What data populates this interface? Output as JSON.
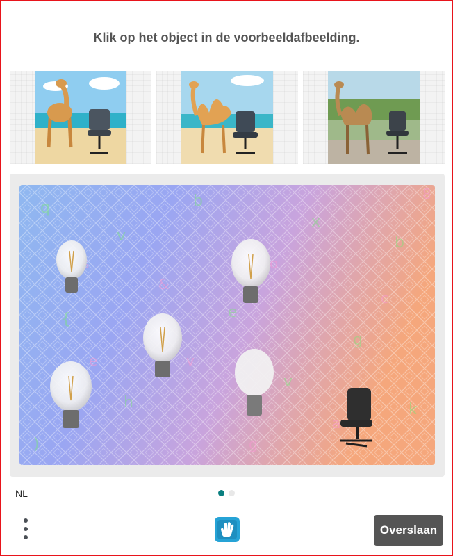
{
  "prompt": {
    "text": "Klik op het object in de voorbeeldafbeelding."
  },
  "examples": [
    {
      "icon": "camel-and-office-chair-on-beach-image"
    },
    {
      "icon": "camel-and-office-chair-on-beach-image"
    },
    {
      "icon": "camel-and-office-chair-in-park-image"
    }
  ],
  "task": {
    "icon": "light-bulbs-and-office-chair-image"
  },
  "footer": {
    "language": "NL",
    "pages_total": 2,
    "page_current": 1,
    "skip_label": "Overslaan",
    "menu_icon": "vertical-dots-icon",
    "logo_icon": "hcaptcha-hand-logo-icon"
  },
  "colors": {
    "accent": "#0a7f80",
    "skip_button": "#555555",
    "border": "#e8141c"
  }
}
